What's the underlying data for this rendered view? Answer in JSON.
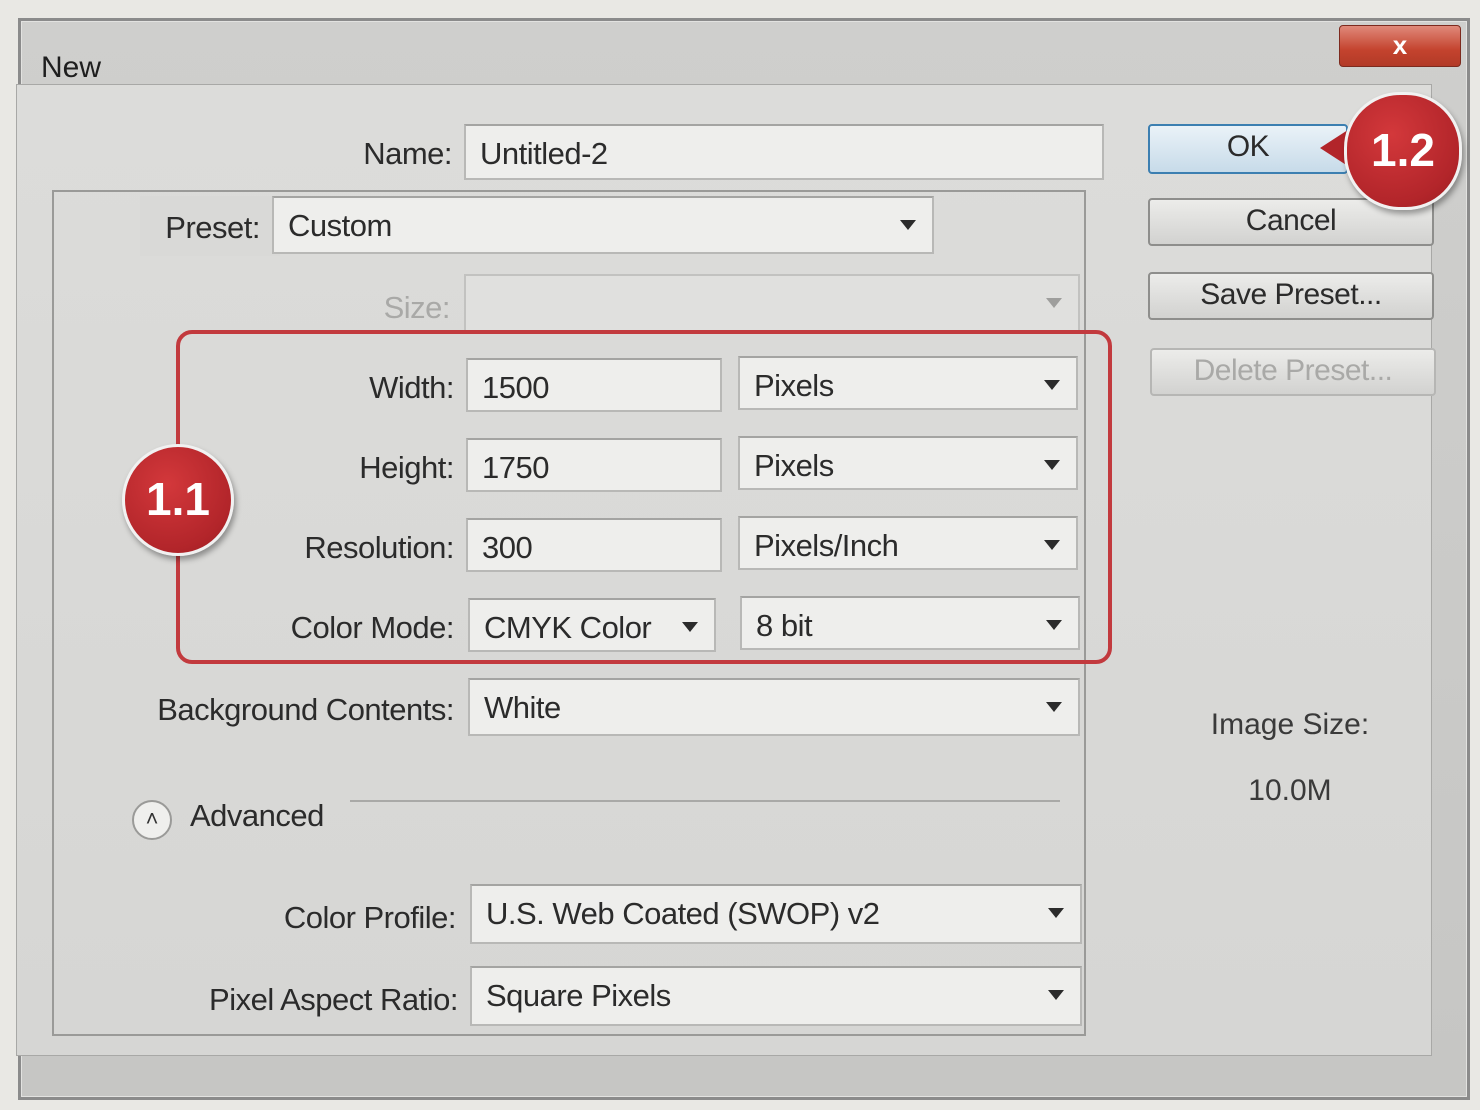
{
  "window": {
    "title": "New",
    "close_symbol": "x"
  },
  "name": {
    "label": "Name:",
    "value": "Untitled-2"
  },
  "preset": {
    "label": "Preset:",
    "value": "Custom"
  },
  "size": {
    "label": "Size:",
    "value": ""
  },
  "width": {
    "label": "Width:",
    "value": "1500",
    "unit": "Pixels"
  },
  "height": {
    "label": "Height:",
    "value": "1750",
    "unit": "Pixels"
  },
  "resolution": {
    "label": "Resolution:",
    "value": "300",
    "unit": "Pixels/Inch"
  },
  "color_mode": {
    "label": "Color Mode:",
    "value": "CMYK Color",
    "depth": "8 bit"
  },
  "background": {
    "label": "Background Contents:",
    "value": "White"
  },
  "advanced": {
    "label": "Advanced",
    "icon": "chevron-up-icon"
  },
  "color_profile": {
    "label": "Color Profile:",
    "value": "U.S. Web Coated (SWOP) v2"
  },
  "pixel_aspect": {
    "label": "Pixel Aspect Ratio:",
    "value": "Square Pixels"
  },
  "buttons": {
    "ok": "OK",
    "cancel": "Cancel",
    "save_preset": "Save Preset...",
    "delete_preset": "Delete Preset..."
  },
  "image_size": {
    "label": "Image Size:",
    "value": "10.0M"
  },
  "annotations": {
    "badge_1": "1.1",
    "badge_2": "1.2"
  },
  "colors": {
    "annotation_red": "#c23a3e",
    "ok_border": "#3c7fb1"
  }
}
